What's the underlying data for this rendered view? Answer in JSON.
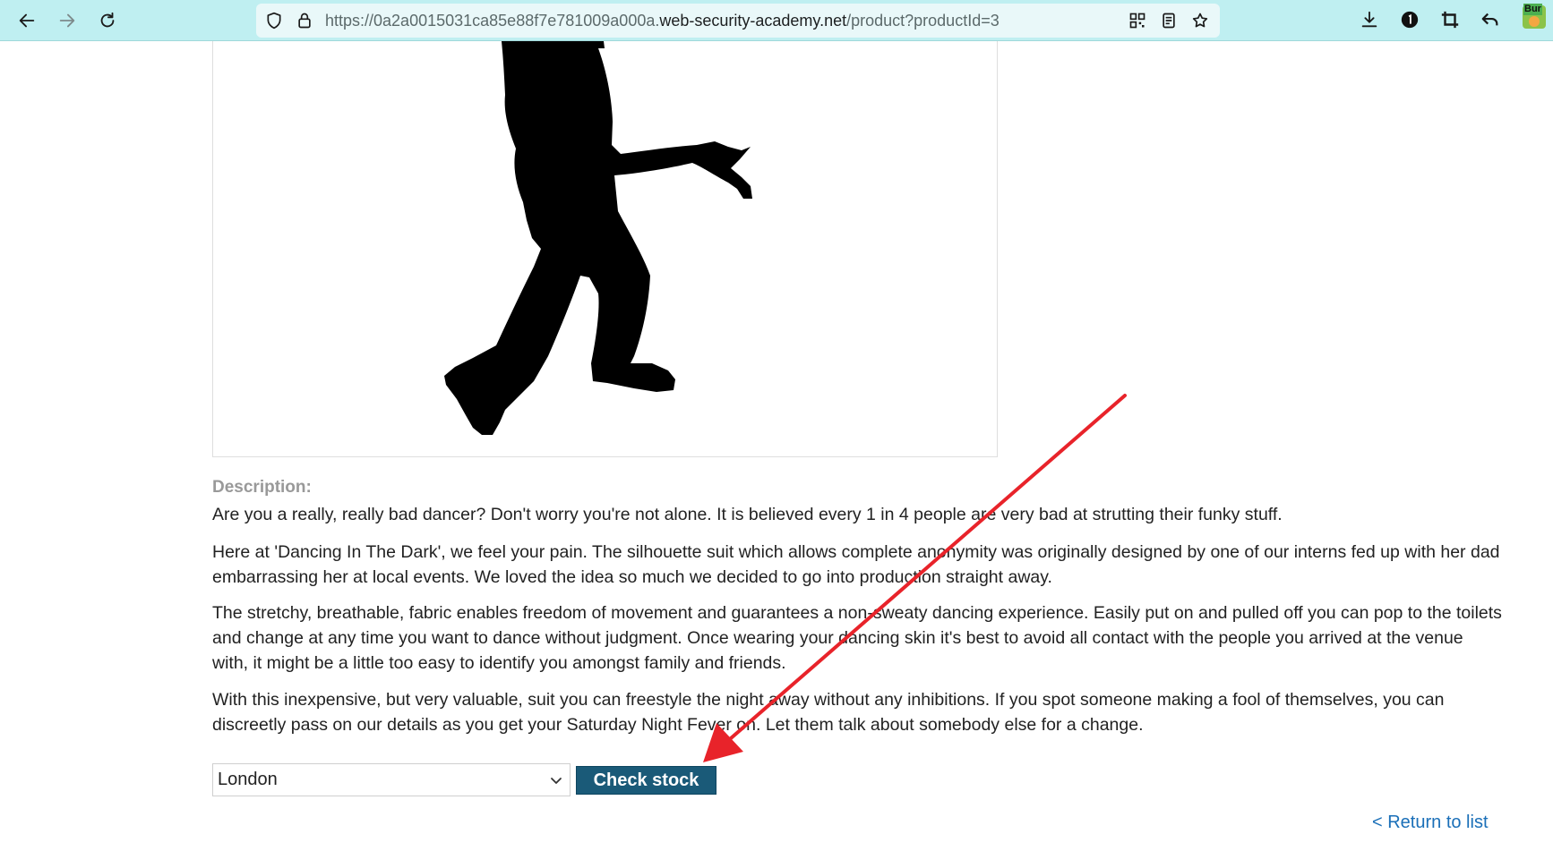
{
  "browser": {
    "url_prefix": "https://0a2a0015031ca85e88f7e781009a000a.",
    "url_host": "web-security-academy.net",
    "url_path": "/product?productId=3",
    "extension_badge": "Bur",
    "icons": {
      "back": "back-arrow-icon",
      "forward": "forward-arrow-icon",
      "reload": "reload-icon",
      "tracking": "shield-icon",
      "lock": "lock-icon",
      "qr": "qr-code-icon",
      "reader": "reader-view-icon",
      "bookmark": "star-icon",
      "download": "download-icon",
      "password": "password-manager-icon",
      "crop": "crop-icon",
      "undo": "undo-icon",
      "extension": "burp-extension-icon"
    }
  },
  "product": {
    "image_alt": "silhouette dancer",
    "description_label": "Description:",
    "paragraphs": [
      "Are you a really, really bad dancer? Don't worry you're not alone. It is believed every 1 in 4 people are very bad at strutting their funky stuff.",
      "Here at 'Dancing In The Dark', we feel your pain. The silhouette suit which allows complete anonymity was originally designed by one of our interns fed up with her dad embarrassing her at local events. We loved the idea so much we decided to go into production straight away.",
      "The stretchy, breathable, fabric enables freedom of movement and guarantees a non-sweaty dancing experience. Easily put on and pulled off you can pop to the toilets and change at any time you want to dance without judgment. Once wearing your dancing skin it's best to avoid all contact with the people you arrived at the venue with, it might be a little too easy to identify you amongst family and friends.",
      "With this inexpensive, but very valuable, suit you can freestyle the night away without any inhibitions. If you spot someone making a fool of themselves, you can discreetly pass on our details as you get your Saturday Night Fever on. Let them talk about somebody else for a change."
    ]
  },
  "stock_check": {
    "selected_store": "London",
    "button_label": "Check stock"
  },
  "footer": {
    "return_link": "< Return to list"
  },
  "colors": {
    "toolbar_bg": "#bfeff1",
    "button_bg": "#1a5a78",
    "link": "#1a6fb8",
    "annotation_arrow": "#e8232a"
  }
}
